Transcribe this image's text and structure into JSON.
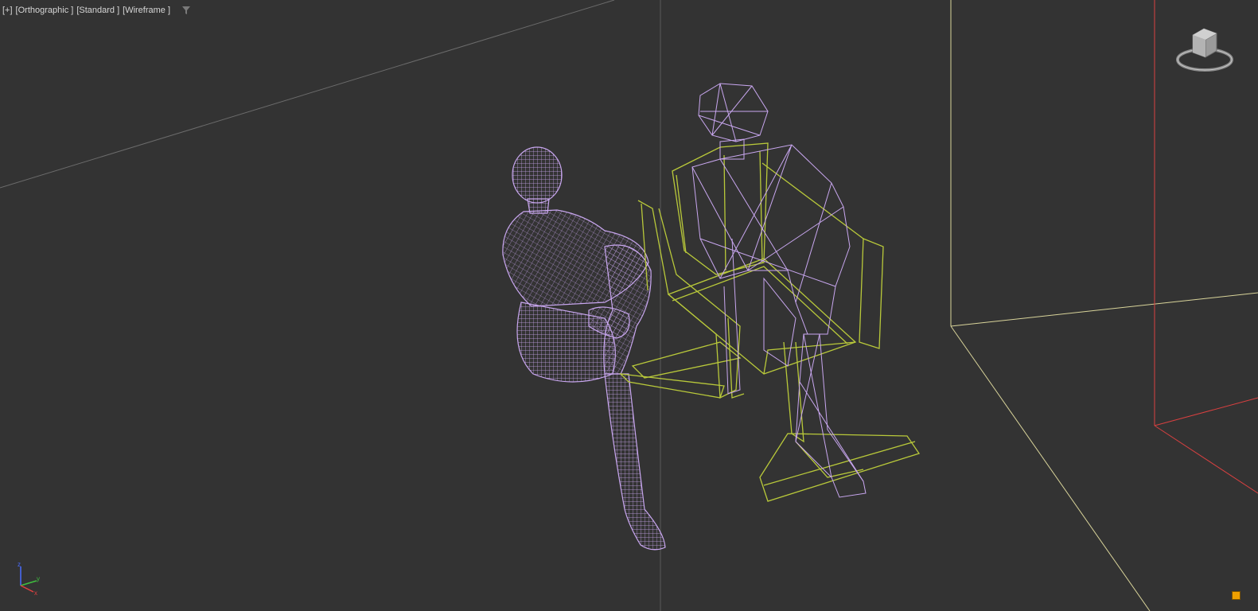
{
  "viewport": {
    "labels": {
      "plus": "[+]",
      "view": "[Orthographic ]",
      "shading": "[Standard ]",
      "mode": "[Wireframe ]"
    }
  },
  "viewcube": {
    "icon": "viewcube-icon"
  },
  "axis_tripod": {
    "x": "x",
    "y": "y",
    "z": "z"
  },
  "colors": {
    "background": "#333333",
    "figure_wire": "#c9a7f0",
    "chair_wire": "#b9c93a",
    "grid_line": "#d9d49a",
    "selection_box": "#d84040",
    "vertical_divider": "#5a5a5a",
    "corner_button": "#f0a000"
  }
}
